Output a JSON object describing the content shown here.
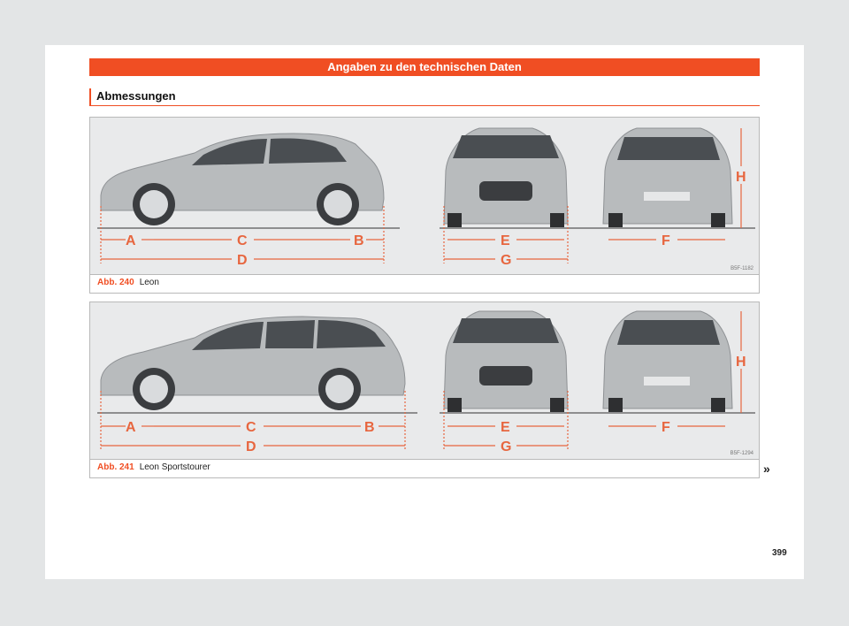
{
  "header": {
    "title": "Angaben zu den technischen Daten"
  },
  "section": {
    "title": "Abmessungen"
  },
  "accent_color": "#f04e23",
  "dimension_color": "#e7663f",
  "figures": [
    {
      "number": "Abb. 240",
      "caption": "Leon",
      "code": "B5F-1182",
      "letters": {
        "a": "A",
        "b": "B",
        "c": "C",
        "d": "D",
        "e": "E",
        "f": "F",
        "g": "G",
        "h": "H"
      }
    },
    {
      "number": "Abb. 241",
      "caption": "Leon Sportstourer",
      "code": "B5F-1294",
      "letters": {
        "a": "A",
        "b": "B",
        "c": "C",
        "d": "D",
        "e": "E",
        "f": "F",
        "g": "G",
        "h": "H"
      }
    }
  ],
  "continue_mark": "»",
  "page_number": "399"
}
